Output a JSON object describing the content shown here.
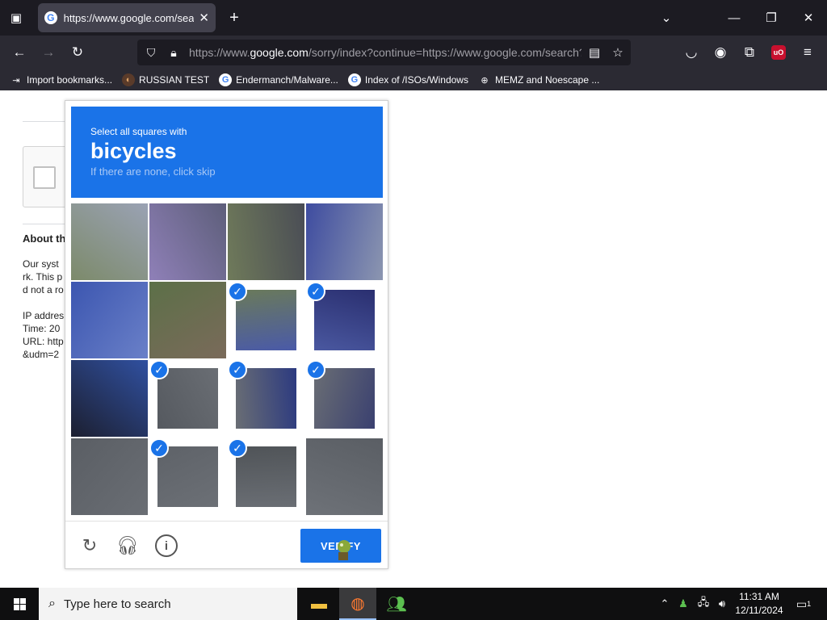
{
  "browser": {
    "tab": {
      "title": "https://www.google.com/search?",
      "favicon": "G"
    },
    "url": {
      "prefix": "https://www.",
      "domain": "google.com",
      "rest": "/sorry/index?continue=https://www.google.com/search?q="
    },
    "bookmarks": [
      {
        "label": "Import bookmarks...",
        "icon": "import-icon"
      },
      {
        "label": "RUSSIAN TEST",
        "icon": "site-icon"
      },
      {
        "label": "Endermanch/Malware...",
        "icon": "google-icon"
      },
      {
        "label": "Index of /ISOs/Windows",
        "icon": "google-icon"
      },
      {
        "label": "MEMZ and Noescape ...",
        "icon": "globe-icon"
      }
    ],
    "ublock_badge": "uO"
  },
  "page": {
    "about_title": "About th",
    "lines": [
      "Our syst",
      "rk. This p",
      "d not a ro",
      "IP addres",
      "Time: 20",
      "URL: http",
      "&udm=2"
    ]
  },
  "captcha": {
    "instruction": "Select all squares with",
    "target": "bicycles",
    "hint": "If there are none, click skip",
    "verify_label": "VERIFY",
    "tiles": [
      {
        "selected": false
      },
      {
        "selected": false
      },
      {
        "selected": false
      },
      {
        "selected": false
      },
      {
        "selected": false
      },
      {
        "selected": false
      },
      {
        "selected": true
      },
      {
        "selected": true
      },
      {
        "selected": false
      },
      {
        "selected": true
      },
      {
        "selected": true
      },
      {
        "selected": true
      },
      {
        "selected": false
      },
      {
        "selected": true
      },
      {
        "selected": true
      },
      {
        "selected": false
      }
    ]
  },
  "taskbar": {
    "search_placeholder": "Type here to search",
    "time": "11:31 AM",
    "date": "12/11/2024",
    "notification_count": "1"
  },
  "colors": {
    "captcha_blue": "#1a73e8",
    "browser_dark": "#1c1b22",
    "toolbar": "#2b2a33"
  }
}
